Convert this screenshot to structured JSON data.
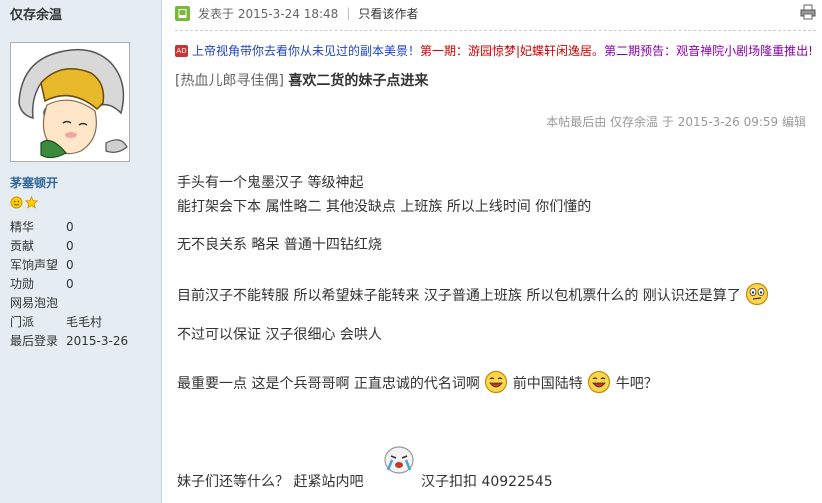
{
  "user": {
    "name": "仅存余温",
    "group": "茅塞顿开",
    "stats": [
      {
        "label": "精华",
        "value": "0"
      },
      {
        "label": "贡献",
        "value": "0"
      },
      {
        "label": "军饷声望",
        "value": "0"
      },
      {
        "label": "功勋",
        "value": "0"
      },
      {
        "label": "网易泡泡",
        "value": ""
      },
      {
        "label": "门派",
        "value": "毛毛村"
      },
      {
        "label": "最后登录",
        "value": "2015-3-26"
      }
    ]
  },
  "post": {
    "posted_label": "发表于 2015-3-24 18:48",
    "separator": "|",
    "author_only": "只看该作者",
    "ad_part1": "上帝视角带你去看你从未见过的副本美景！",
    "ad_part2": "第一期：游园惊梦|妃蝶轩闲逸居。",
    "ad_part3": "第二期预告：观音禅院小剧场隆重推出!",
    "category": "[热血儿郎寻佳偶]",
    "title": "喜欢二货的妹子点进来",
    "edit_note": "本帖最后由 仅存余温 于 2015-3-26 09:59 编辑",
    "lines": [
      "手头有一个鬼墨汉子   等级神起",
      "能打架会下本 属性略二  其他没缺点   上班族   所以上线时间 你们懂的",
      "无不良关系 略呆 普通十四钻红烧",
      "目前汉子不能转服 所以希望妹子能转来 汉子普通上班族 所以包机票什么的 刚认识还是算了",
      "不过可以保证 汉子很细心 会哄人",
      "最重要一点  这是个兵哥哥啊   正直忠诚的代名词啊",
      "前中国陆特",
      "牛吧？",
      "妹子们还等什么？ 赶紧站内吧",
      "汉子扣扣 40922545"
    ]
  },
  "icons": {
    "online": "online-status-icon",
    "print": "print-icon",
    "ad": "ad-badge-icon"
  },
  "colors": {
    "sidebar_bg": "#e5edf2",
    "ad_blue": "#1e43c8",
    "ad_red": "#cc0000",
    "ad_purple": "#8b00aa"
  }
}
